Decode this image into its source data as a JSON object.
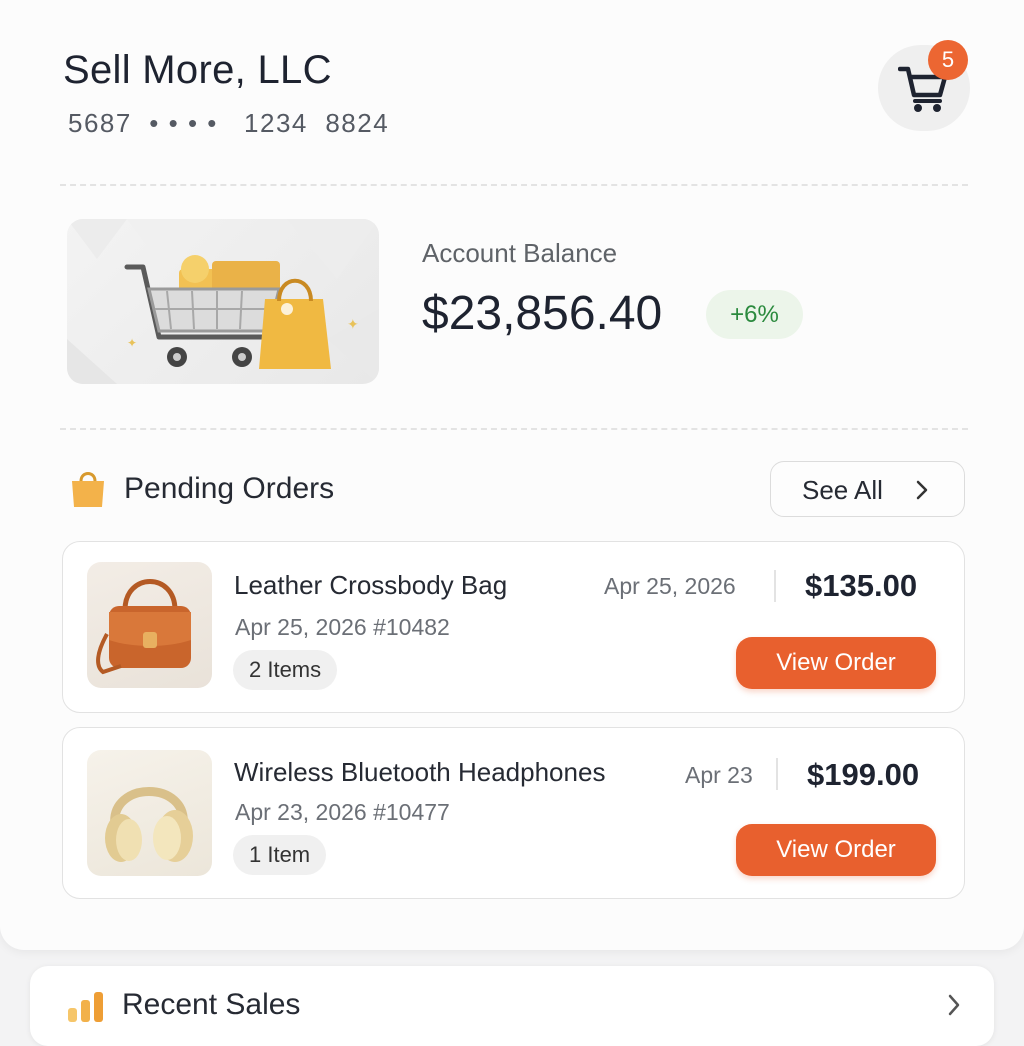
{
  "header": {
    "company_name": "Sell More, LLC",
    "account_number": "5687  • • • •   1234  8824",
    "cart_badge_count": "5"
  },
  "balance": {
    "label": "Account Balance",
    "value": "$23,856.40",
    "change": "+6%"
  },
  "pending_orders": {
    "title": "Pending Orders",
    "see_all_label": "See All",
    "orders": [
      {
        "name": "Leather Crossbody Bag",
        "date_short": "Apr 25, 2026",
        "price": "$135.00",
        "meta": "Apr 25, 2026  #10482",
        "count": "2 Items",
        "button": "View Order"
      },
      {
        "name": "Wireless Bluetooth Headphones",
        "date_short": "Apr 23",
        "price": "$199.00",
        "meta": "Apr 23, 2026  #10477",
        "count": "1 Item",
        "button": "View Order"
      }
    ]
  },
  "recent_sales": {
    "title": "Recent Sales"
  },
  "colors": {
    "accent": "#e8602e",
    "badge": "#ec6632",
    "positive_text": "#2b8a3e",
    "positive_bg": "#ecf5ea"
  },
  "icons": [
    "shopping-cart-icon",
    "shopping-bag-icon",
    "chevron-right-icon",
    "bar-chart-icon"
  ]
}
